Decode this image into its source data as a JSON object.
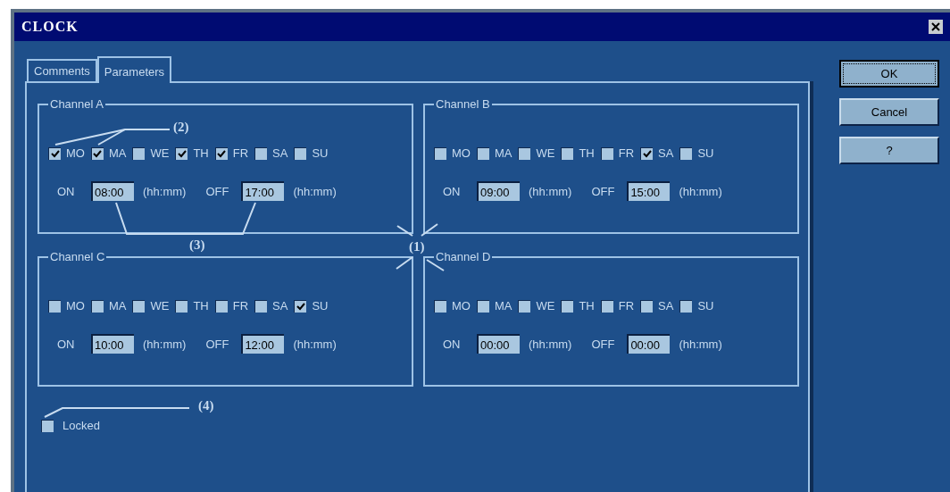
{
  "window": {
    "title": "CLOCK"
  },
  "tabs": [
    {
      "label": "Comments",
      "selected": false
    },
    {
      "label": "Parameters",
      "selected": true
    }
  ],
  "channels": [
    {
      "title": "Channel A",
      "days": [
        {
          "label": "MO",
          "checked": true
        },
        {
          "label": "MA",
          "checked": true
        },
        {
          "label": "WE",
          "checked": false
        },
        {
          "label": "TH",
          "checked": true
        },
        {
          "label": "FR",
          "checked": true
        },
        {
          "label": "SA",
          "checked": false
        },
        {
          "label": "SU",
          "checked": false
        }
      ],
      "on_label": "ON",
      "on_time": "08:00",
      "on_unit": "(hh:mm)",
      "off_label": "OFF",
      "off_time": "17:00",
      "off_unit": "(hh:mm)"
    },
    {
      "title": "Channel B",
      "days": [
        {
          "label": "MO",
          "checked": false
        },
        {
          "label": "MA",
          "checked": false
        },
        {
          "label": "WE",
          "checked": false
        },
        {
          "label": "TH",
          "checked": false
        },
        {
          "label": "FR",
          "checked": false
        },
        {
          "label": "SA",
          "checked": true
        },
        {
          "label": "SU",
          "checked": false
        }
      ],
      "on_label": "ON",
      "on_time": "09:00",
      "on_unit": "(hh:mm)",
      "off_label": "OFF",
      "off_time": "15:00",
      "off_unit": "(hh:mm)"
    },
    {
      "title": "Channel C",
      "days": [
        {
          "label": "MO",
          "checked": false
        },
        {
          "label": "MA",
          "checked": false
        },
        {
          "label": "WE",
          "checked": false
        },
        {
          "label": "TH",
          "checked": false
        },
        {
          "label": "FR",
          "checked": false
        },
        {
          "label": "SA",
          "checked": false
        },
        {
          "label": "SU",
          "checked": true
        }
      ],
      "on_label": "ON",
      "on_time": "10:00",
      "on_unit": "(hh:mm)",
      "off_label": "OFF",
      "off_time": "12:00",
      "off_unit": "(hh:mm)"
    },
    {
      "title": "Channel D",
      "days": [
        {
          "label": "MO",
          "checked": false
        },
        {
          "label": "MA",
          "checked": false
        },
        {
          "label": "WE",
          "checked": false
        },
        {
          "label": "TH",
          "checked": false
        },
        {
          "label": "FR",
          "checked": false
        },
        {
          "label": "SA",
          "checked": false
        },
        {
          "label": "SU",
          "checked": false
        }
      ],
      "on_label": "ON",
      "on_time": "00:00",
      "on_unit": "(hh:mm)",
      "off_label": "OFF",
      "off_time": "00:00",
      "off_unit": "(hh:mm)"
    }
  ],
  "locked": {
    "label": "Locked",
    "checked": false
  },
  "buttons": [
    {
      "label": "OK",
      "focused": true
    },
    {
      "label": "Cancel",
      "focused": false
    },
    {
      "label": "?",
      "focused": false
    }
  ],
  "callouts": [
    {
      "label": "(1)"
    },
    {
      "label": "(2)"
    },
    {
      "label": "(3)"
    },
    {
      "label": "(4)"
    }
  ]
}
